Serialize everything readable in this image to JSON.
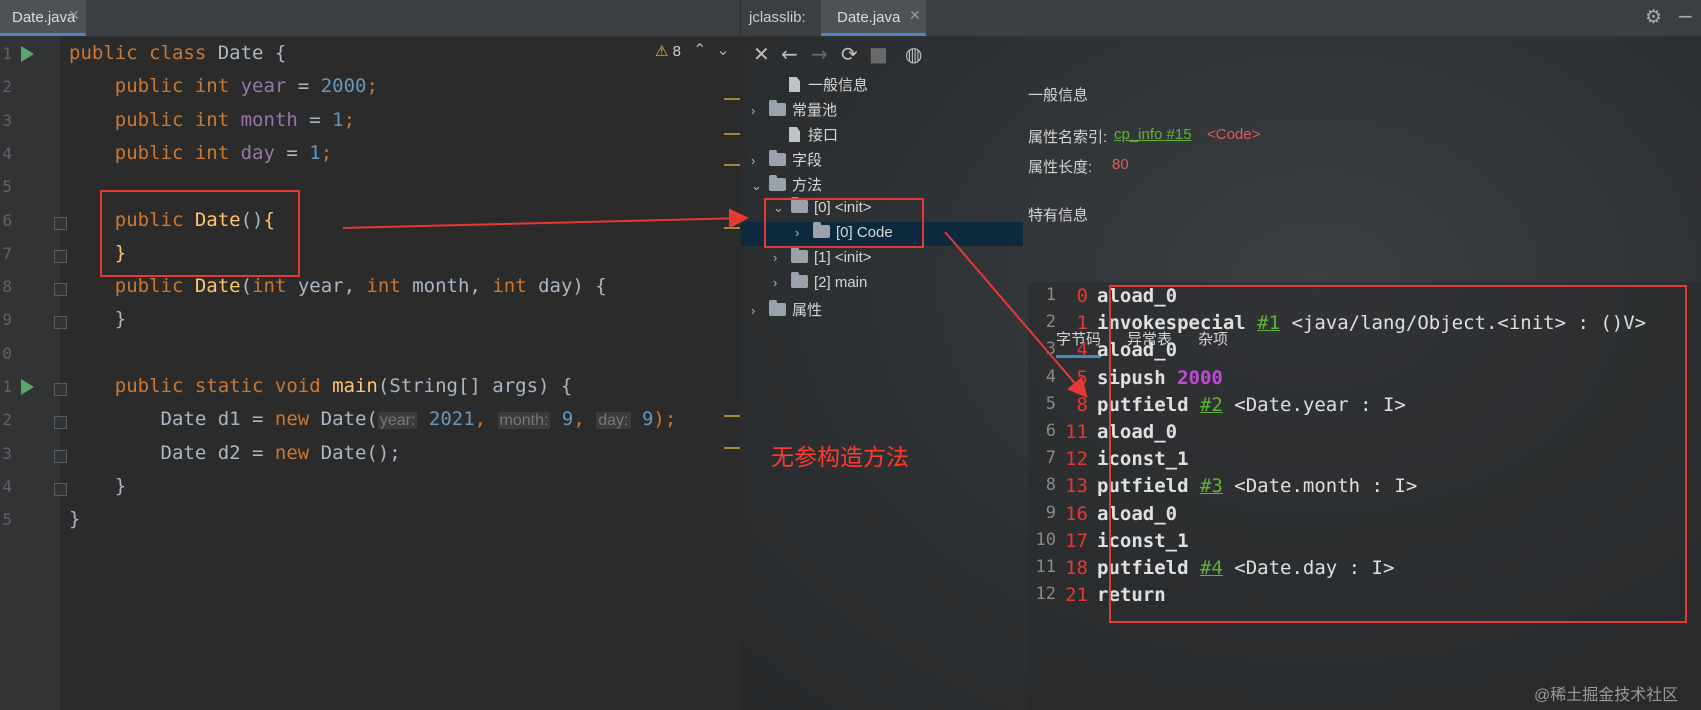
{
  "editor": {
    "file_tab": "Date.java",
    "warning_count": "8",
    "line_numbers": [
      "1",
      "2",
      "3",
      "4",
      "5",
      "6",
      "7",
      "8",
      "9",
      "0",
      "1",
      "2",
      "3",
      "4",
      "5"
    ],
    "lines": [
      [
        {
          "t": "public class ",
          "c": "kw"
        },
        {
          "t": "Date {",
          "c": "par"
        }
      ],
      [
        {
          "t": "    public int ",
          "c": "kw"
        },
        {
          "t": "year",
          "c": "fld"
        },
        {
          "t": " = ",
          "c": "par"
        },
        {
          "t": "2000",
          "c": "num"
        },
        {
          "t": ";",
          "c": "kw"
        }
      ],
      [
        {
          "t": "    public int ",
          "c": "kw"
        },
        {
          "t": "month",
          "c": "fld"
        },
        {
          "t": " = ",
          "c": "par"
        },
        {
          "t": "1",
          "c": "num"
        },
        {
          "t": ";",
          "c": "kw"
        }
      ],
      [
        {
          "t": "    public int ",
          "c": "kw"
        },
        {
          "t": "day",
          "c": "fld"
        },
        {
          "t": " = ",
          "c": "par"
        },
        {
          "t": "1",
          "c": "num"
        },
        {
          "t": ";",
          "c": "kw"
        }
      ],
      [],
      [
        {
          "t": "    public ",
          "c": "kw"
        },
        {
          "t": "Date",
          "c": "fn"
        },
        {
          "t": "()",
          "c": "par"
        },
        {
          "t": "{",
          "c": "fn"
        }
      ],
      [
        {
          "t": "    ",
          "c": "par"
        },
        {
          "t": "}",
          "c": "fn"
        }
      ],
      [
        {
          "t": "    public ",
          "c": "kw"
        },
        {
          "t": "Date",
          "c": "fn"
        },
        {
          "t": "(",
          "c": "par"
        },
        {
          "t": "int ",
          "c": "kw"
        },
        {
          "t": "year, ",
          "c": "par"
        },
        {
          "t": "int ",
          "c": "kw"
        },
        {
          "t": "month, ",
          "c": "par"
        },
        {
          "t": "int ",
          "c": "kw"
        },
        {
          "t": "day) {",
          "c": "par"
        }
      ],
      [
        {
          "t": "    }",
          "c": "par"
        }
      ],
      [],
      [
        {
          "t": "    public static void ",
          "c": "kw"
        },
        {
          "t": "main",
          "c": "fn"
        },
        {
          "t": "(String[] args) {",
          "c": "par"
        }
      ],
      [
        {
          "t": "        Date d1 = ",
          "c": "par"
        },
        {
          "t": "new ",
          "c": "kw"
        },
        {
          "t": "Date(",
          "c": "par"
        },
        {
          "t": "year:",
          "c": "hint"
        },
        {
          "t": " 2021",
          "c": "num"
        },
        {
          "t": ", ",
          "c": "kw"
        },
        {
          "t": "month:",
          "c": "hint"
        },
        {
          "t": " 9",
          "c": "num"
        },
        {
          "t": ", ",
          "c": "kw"
        },
        {
          "t": "day:",
          "c": "hint"
        },
        {
          "t": " 9",
          "c": "num"
        },
        {
          "t": ");",
          "c": "kw"
        }
      ],
      [
        {
          "t": "        Date d2 = ",
          "c": "par"
        },
        {
          "t": "new ",
          "c": "kw"
        },
        {
          "t": "Date();",
          "c": "par"
        }
      ],
      [
        {
          "t": "    }",
          "c": "par"
        }
      ],
      [
        {
          "t": "}",
          "c": "par"
        }
      ]
    ]
  },
  "jclasslib": {
    "plugin_label": "jclasslib:",
    "file_tab": "Date.java",
    "tree": [
      {
        "label": "一般信息",
        "type": "file"
      },
      {
        "label": "常量池",
        "type": "folder"
      },
      {
        "label": "接口",
        "type": "file"
      },
      {
        "label": "字段",
        "type": "folder"
      },
      {
        "label": "方法",
        "type": "folder"
      },
      {
        "label": "[0] <init>",
        "type": "folder"
      },
      {
        "label": "[0] Code",
        "type": "folder"
      },
      {
        "label": "[1] <init>",
        "type": "folder"
      },
      {
        "label": "[2] main",
        "type": "folder"
      },
      {
        "label": "属性",
        "type": "folder"
      }
    ],
    "detail": {
      "general_header": "一般信息",
      "name_index_label": "属性名索引:",
      "name_index_link": "cp_info #15",
      "name_index_value": "<Code>",
      "length_label": "属性长度:",
      "length_value": "80",
      "specific_header": "特有信息",
      "tabs": [
        "字节码",
        "异常表",
        "杂项"
      ]
    },
    "bytecode": [
      {
        "ln": "1",
        "off": "0",
        "op": "aload_0",
        "ref": "",
        "val": "",
        "cmt": ""
      },
      {
        "ln": "2",
        "off": "1",
        "op": "invokespecial ",
        "ref": "#1",
        "val": "",
        "cmt": " <java/lang/Object.<init> : ()V>"
      },
      {
        "ln": "3",
        "off": "4",
        "op": "aload_0",
        "ref": "",
        "val": "",
        "cmt": ""
      },
      {
        "ln": "4",
        "off": "5",
        "op": "sipush ",
        "ref": "",
        "val": "2000",
        "cmt": ""
      },
      {
        "ln": "5",
        "off": "8",
        "op": "putfield ",
        "ref": "#2",
        "val": "",
        "cmt": " <Date.year : I>"
      },
      {
        "ln": "6",
        "off": "11",
        "op": "aload_0",
        "ref": "",
        "val": "",
        "cmt": ""
      },
      {
        "ln": "7",
        "off": "12",
        "op": "iconst_1",
        "ref": "",
        "val": "",
        "cmt": ""
      },
      {
        "ln": "8",
        "off": "13",
        "op": "putfield ",
        "ref": "#3",
        "val": "",
        "cmt": " <Date.month : I>"
      },
      {
        "ln": "9",
        "off": "16",
        "op": "aload_0",
        "ref": "",
        "val": "",
        "cmt": ""
      },
      {
        "ln": "10",
        "off": "17",
        "op": "iconst_1",
        "ref": "",
        "val": "",
        "cmt": ""
      },
      {
        "ln": "11",
        "off": "18",
        "op": "putfield ",
        "ref": "#4",
        "val": "",
        "cmt": " <Date.day : I>"
      },
      {
        "ln": "12",
        "off": "21",
        "op": "return",
        "ref": "",
        "val": "",
        "cmt": ""
      }
    ]
  },
  "annotation": "无参构造方法",
  "watermark": "@稀土掘金技术社区",
  "colors": {
    "annotation_red": "#e53935",
    "link_green": "#5fb336",
    "accent_blue": "#4a88c7"
  }
}
